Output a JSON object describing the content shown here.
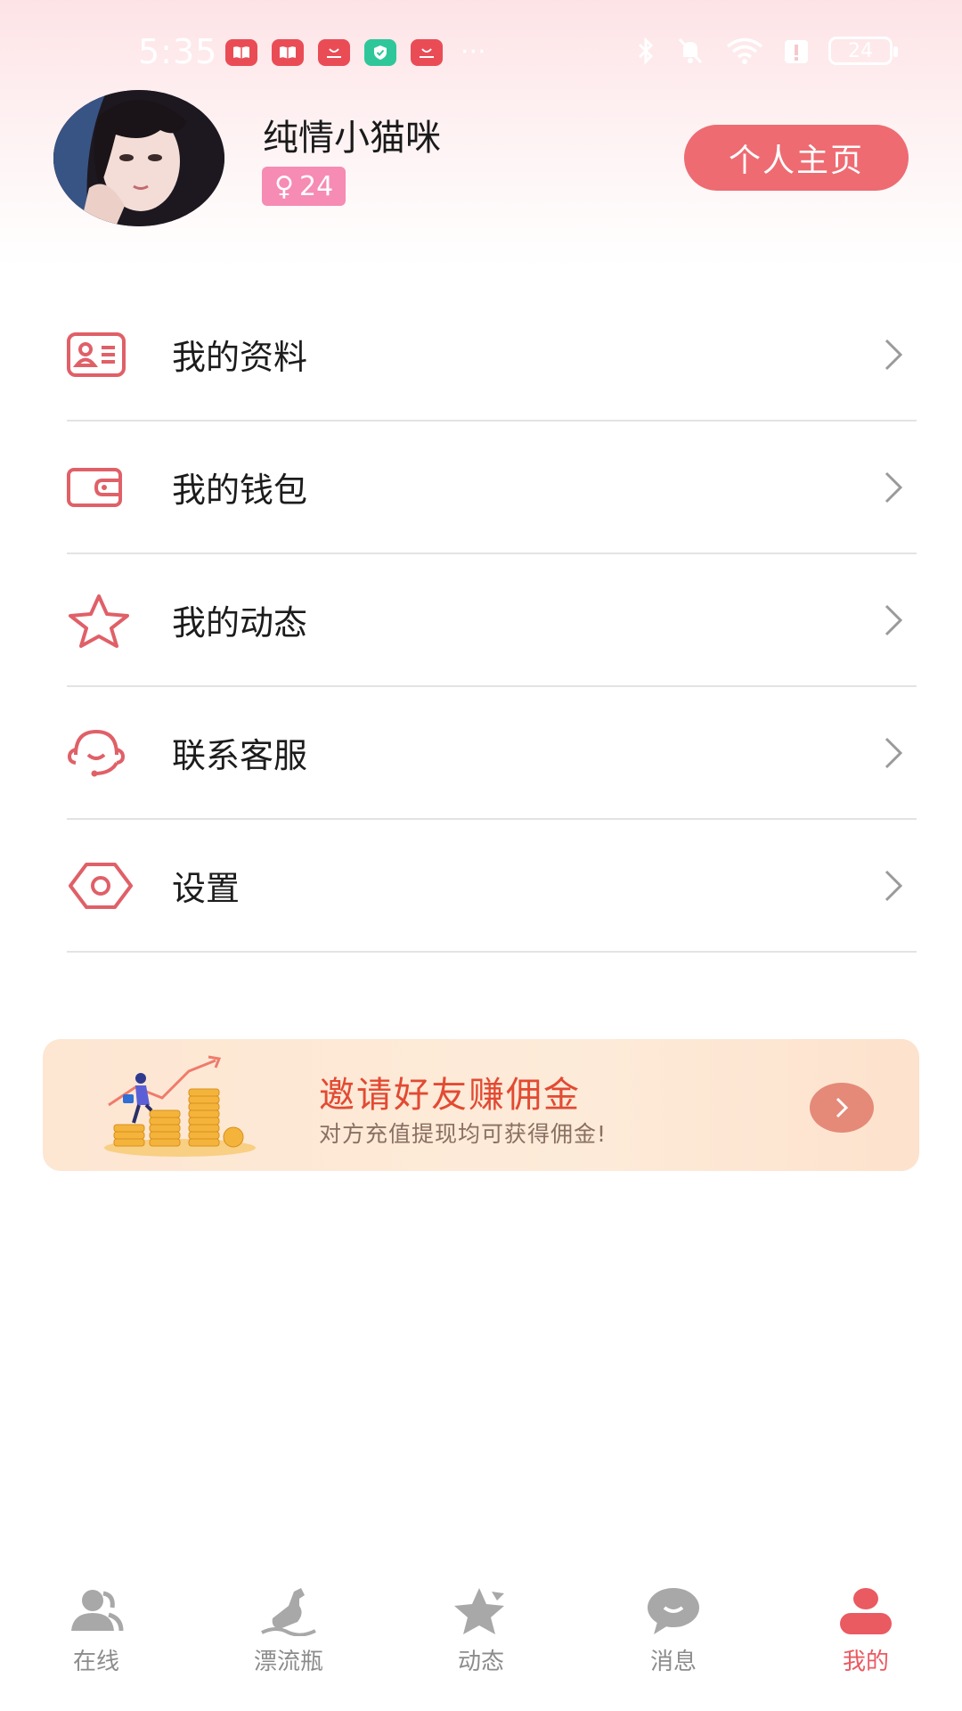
{
  "status_bar": {
    "time": "5:35",
    "notification_icons": [
      "book-icon",
      "book-icon",
      "huawei-store-icon",
      "shield-check-icon",
      "huawei-store-icon"
    ],
    "more": "···",
    "system_icons": [
      "bluetooth-icon",
      "mute-icon",
      "wifi-icon",
      "alert-icon"
    ],
    "battery": "24"
  },
  "profile": {
    "username": "纯情小猫咪",
    "gender_symbol": "♀",
    "age": "24",
    "home_button": "个人主页"
  },
  "menu": {
    "items": [
      {
        "label": "我的资料",
        "icon": "id-card-icon"
      },
      {
        "label": "我的钱包",
        "icon": "wallet-icon"
      },
      {
        "label": "我的动态",
        "icon": "star-icon"
      },
      {
        "label": "联系客服",
        "icon": "headset-icon"
      },
      {
        "label": "设置",
        "icon": "gear-icon"
      }
    ]
  },
  "banner": {
    "title": "邀请好友赚佣金",
    "subtitle": "对方充值提现均可获得佣金!"
  },
  "bottom_nav": {
    "items": [
      {
        "label": "在线",
        "icon": "users-icon",
        "active": false
      },
      {
        "label": "漂流瓶",
        "icon": "bottle-icon",
        "active": false
      },
      {
        "label": "动态",
        "icon": "star-icon",
        "active": false
      },
      {
        "label": "消息",
        "icon": "chat-icon",
        "active": false
      },
      {
        "label": "我的",
        "icon": "person-icon",
        "active": true
      }
    ]
  },
  "colors": {
    "accent": "#ee6b72",
    "menu_icon": "#e06068",
    "badge": "#f68bb4",
    "banner_title": "#e24a33",
    "nav_inactive": "#9e9e9e",
    "nav_active": "#ea5a61"
  }
}
